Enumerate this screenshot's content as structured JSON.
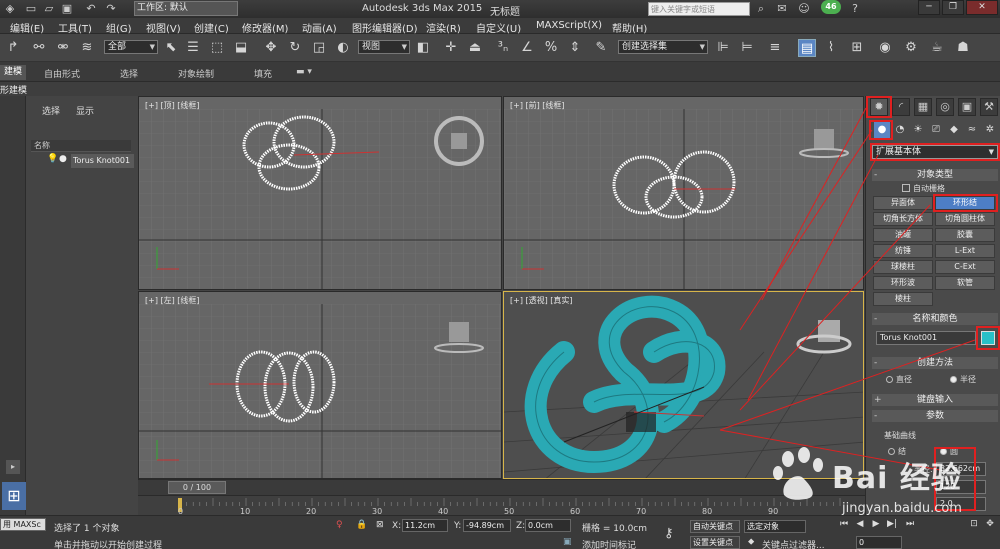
{
  "titlebar": {
    "workspace": "工作区: 默认",
    "app_title": "Autodesk 3ds Max  2015",
    "doc_title": "无标题",
    "search_placeholder": "键入关键字或短语",
    "badge": "46"
  },
  "menu": [
    "编辑(E)",
    "工具(T)",
    "组(G)",
    "视图(V)",
    "创建(C)",
    "修改器(M)",
    "动画(A)",
    "图形编辑器(D)",
    "渲染(R)",
    "自定义(U)",
    "MAXScript(X)",
    "帮助(H)"
  ],
  "toolbar": {
    "filter_dropdown": "全部",
    "coord_dropdown": "视图",
    "selset_dropdown": "创建选择集"
  },
  "ribbon": {
    "tabs": [
      "建模",
      "自由形式",
      "选择",
      "对象绘制",
      "填充"
    ],
    "subtab": "形建模"
  },
  "explorer": {
    "select": "选择",
    "display": "显示",
    "col_name": "名称",
    "object": "Torus Knot001"
  },
  "viewports": {
    "top": "[+] [顶] [线框]",
    "front": "[+] [前] [线框]",
    "left": "[+] [左] [线框]",
    "persp": "[+] [透视] [真实]"
  },
  "command_panel": {
    "category_dropdown": "扩展基本体",
    "object_type_title": "对象类型",
    "autogrid": "自动栅格",
    "buttons": [
      "异面体",
      "环形结",
      "切角长方体",
      "切角圆柱体",
      "油罐",
      "胶囊",
      "纺锤",
      "L-Ext",
      "球棱柱",
      "C-Ext",
      "环形波",
      "软管",
      "棱柱"
    ],
    "name_color_title": "名称和颜色",
    "name_value": "Torus Knot001",
    "object_color": "#28c0c8",
    "creation_method_title": "创建方法",
    "method_diameter": "直径",
    "method_radius": "半径",
    "keyboard_entry_title": "键盘输入",
    "params_title": "参数",
    "base_curve_title": "基础曲线",
    "knot": "结",
    "circle": "圆",
    "radius_label": "半径:",
    "radius_value": "32.662cm",
    "segments_value": "120",
    "p_value": "2.0"
  },
  "timeline": {
    "frame": "0 / 100",
    "ticks": [
      "0",
      "10",
      "20",
      "30",
      "40",
      "50",
      "60",
      "70",
      "80",
      "90"
    ]
  },
  "status": {
    "maxscript": "用 MAXSc",
    "selected": "选择了 1 个对象",
    "prompt": "单击并拖动以开始创建过程",
    "x_label": "X:",
    "x_value": "11.2cm",
    "y_label": "Y:",
    "y_value": "-94.89cm",
    "z_label": "Z:",
    "z_value": "0.0cm",
    "grid": "栅格 = 10.0cm",
    "add_time_tag": "添加时间标记",
    "auto_key": "自动关键点",
    "set_key": "设置关键点",
    "sel_object": "选定对象",
    "key_filters": "关键点过滤器...",
    "frame_field": "0"
  },
  "watermark": {
    "brand": "Bai 经验",
    "url": "jingyan.baidu.com"
  }
}
